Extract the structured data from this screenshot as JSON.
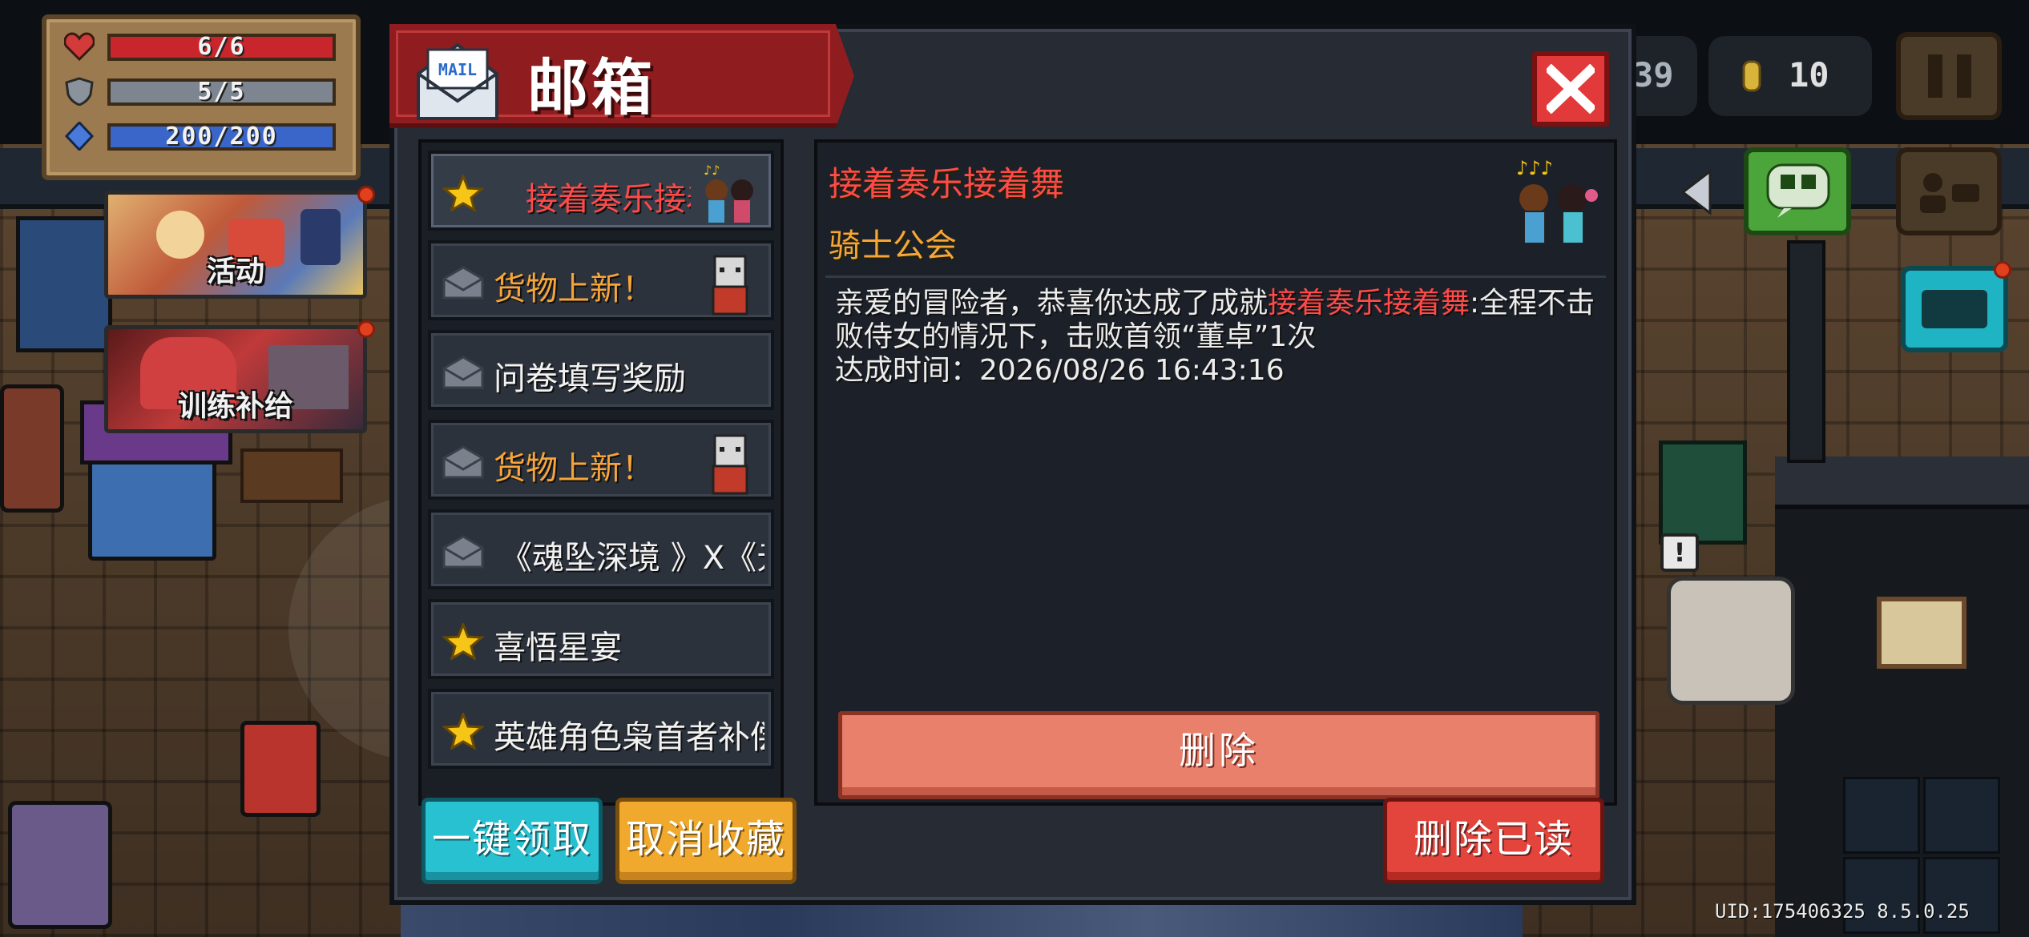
{
  "hud": {
    "health": "6/6",
    "armor": "5/5",
    "energy": "200/200",
    "gems_partial": "39",
    "coins": "10",
    "colors": {
      "health": "#c8262c",
      "armor": "#7c8590",
      "energy": "#3a66c9"
    }
  },
  "banners": [
    {
      "label": "活动"
    },
    {
      "label": "训练补给"
    }
  ],
  "mailbox": {
    "title": "邮箱",
    "mail_icon_text": "MAIL",
    "items": [
      {
        "icon": "star-icon",
        "title": "接着奏乐接着舞",
        "title_color": "#ff4a4a",
        "has_thumb": true,
        "thumb": "dancing-girls-icon"
      },
      {
        "icon": "envelope-icon",
        "title": "货物上新！",
        "title_color": "#f6a53a",
        "has_thumb": true,
        "thumb": "cat-merchant-icon"
      },
      {
        "icon": "envelope-icon",
        "title": "问卷填写奖励",
        "title_color": "#f2f2f2",
        "has_thumb": false
      },
      {
        "icon": "envelope-icon",
        "title": "货物上新！",
        "title_color": "#f6a53a",
        "has_thumb": true,
        "thumb": "cat-merchant-icon"
      },
      {
        "icon": "envelope-icon",
        "title": "《魂坠深境 》X《元",
        "title_color": "#f2f2f2",
        "has_thumb": false
      },
      {
        "icon": "star-icon",
        "title": "喜悟星宴",
        "title_color": "#f2f2f2",
        "has_thumb": false
      },
      {
        "icon": "star-icon",
        "title": "英雄角色枭首者补偿",
        "title_color": "#f2f2f2",
        "has_thumb": false
      }
    ],
    "detail": {
      "title": "接着奏乐接着舞",
      "sender": "骑士公会",
      "body_prefix": "亲爱的冒险者，恭喜你达成了成就",
      "body_highlight": "接着奏乐接着舞",
      "body_suffix": ":全程不击败侍女的情况下，击败首领“董卓”1次",
      "time_line": "达成时间：2026/08/26 16:43:16",
      "delete_label": "删除"
    },
    "footer": {
      "claim_all": "一键领取",
      "unfavorite": "取消收藏",
      "delete_read": "删除已读"
    }
  },
  "uid_text": "UID:175406325 8.5.0.25"
}
